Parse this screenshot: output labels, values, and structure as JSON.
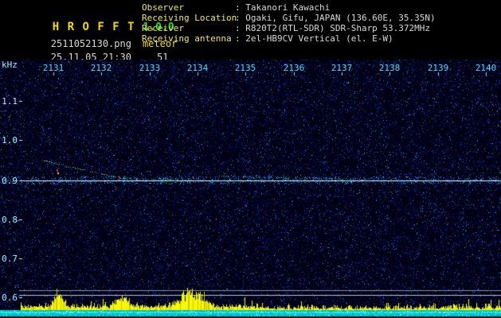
{
  "app": {
    "title": "H R O F F T",
    "version": "1.0.0",
    "filename": "2511052130.png",
    "mode": "meteor",
    "datetime": "25.11.05 21:30",
    "count": "51"
  },
  "info": {
    "rows": [
      {
        "label": "Observer",
        "value": ": Takanori Kawachi"
      },
      {
        "label": "Receiving Location",
        "value": ": Ogaki, Gifu, JAPAN (136.60E, 35.35N)"
      },
      {
        "label": "Receiver",
        "value": ": R820T2(RTL-SDR) SDR-Sharp 53.372MHz"
      },
      {
        "label": "Receiving antenna",
        "value": ": 2el-HB9CV Vertical (el. E-W)"
      }
    ]
  },
  "spectrogram": {
    "unit_label": "kHz",
    "time_labels": [
      "2131",
      "2132",
      "2133",
      "2134",
      "2135",
      "2136",
      "2137",
      "2138",
      "2139",
      "2140"
    ],
    "freq_labels": [
      "1.1",
      "1.0",
      "0.9",
      "0.8",
      "0.7",
      "0.6"
    ],
    "carrier_khz": 0.9,
    "colors": {
      "background": "#000014",
      "noise_blue": "#1445c8",
      "carrier_line": "#d8f8ff",
      "trace_green": "#20d060",
      "marker_red": "#e82848",
      "meter_bars": "#f8f800",
      "meter_band": "#00c4cc",
      "axis_labels": "#3fe0ff",
      "header_yellow": "#f0dc00",
      "header_green": "#20e020"
    }
  }
}
